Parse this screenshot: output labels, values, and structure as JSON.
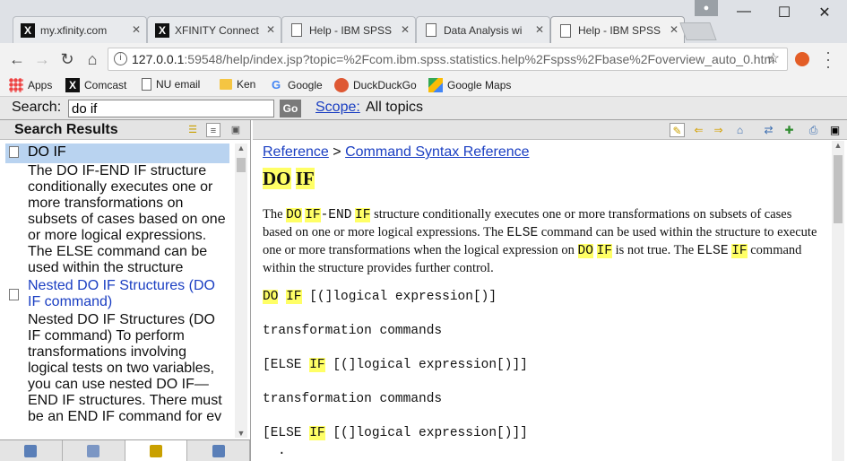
{
  "browser": {
    "tabs": [
      {
        "label": "my.xfinity.com",
        "icon": "xfinity-icon"
      },
      {
        "label": "XFINITY Connect",
        "icon": "xfinity-icon"
      },
      {
        "label": "Help - IBM SPSS",
        "icon": "document-icon"
      },
      {
        "label": "Data Analysis wi",
        "icon": "document-icon"
      },
      {
        "label": "Help - IBM SPSS",
        "icon": "document-icon",
        "active": true
      }
    ],
    "close_glyph": "✕",
    "url_host": "127.0.0.1",
    "url_rest": ":59548/help/index.jsp?topic=%2Fcom.ibm.spss.statistics.help%2Fspss%2Fbase%2Foverview_auto_0.htm",
    "bookmarks": [
      {
        "label": "Apps",
        "icon": "apps-grid-icon"
      },
      {
        "label": "Comcast",
        "icon": "xfinity-icon"
      },
      {
        "label": "NU email",
        "icon": "document-icon"
      },
      {
        "label": "Ken",
        "icon": "folder-icon"
      },
      {
        "label": "Google",
        "icon": "google-icon"
      },
      {
        "label": "DuckDuckGo",
        "icon": "duckduckgo-icon"
      },
      {
        "label": "Google Maps",
        "icon": "google-maps-icon"
      }
    ]
  },
  "search": {
    "label": "Search:",
    "value": "do if",
    "go_label": "Go",
    "scope_label": "Scope:",
    "scope_value": "All topics"
  },
  "left_pane": {
    "title": "Search Results",
    "results": [
      {
        "title": "DO IF",
        "description": "The DO IF-END IF structure conditionally executes one or more transformations on subsets of cases based on one or more logical expressions. The ELSE command can be used within the structure",
        "selected": true
      },
      {
        "title": "Nested DO IF Structures (DO IF command)",
        "description": "Nested DO IF Structures (DO IF command) To perform transformations involving logical tests on two variables, you can use nested DO IF—END IF structures. There must be an END IF command for ev"
      }
    ]
  },
  "content": {
    "breadcrumb": {
      "first": "Reference",
      "sep": ">",
      "second": "Command Syntax Reference"
    },
    "heading_a": "DO",
    "heading_b": "IF",
    "para": {
      "t1": "The",
      "k1": "DO",
      "k2": "IF",
      "k3": "-END",
      "k4": "IF",
      "t2": "structure conditionally executes one or more transformations on subsets of cases based on one or more logical expressions. The",
      "k5": "ELSE",
      "t3": "command can be used within the structure to execute one or more transformations when the logical expression on",
      "k6": "DO",
      "k7": "IF",
      "t4": "is not true. The",
      "k8": "ELSE",
      "k9": "IF",
      "t5": "command within the structure provides further control."
    },
    "syntax": {
      "l1a": "DO",
      "l1b": "IF",
      "l1c": "[(]logical expression[)]",
      "l2": "transformation commands",
      "l3a": "[ELSE",
      "l3b": "IF",
      "l3c": "[(]logical expression[)]]",
      "l4": "transformation commands",
      "l5a": "[ELSE",
      "l5b": "IF",
      "l5c": "[(]logical expression[)]]",
      "l6": "."
    }
  },
  "colors": {
    "highlight": "#ffff66",
    "link": "#1a3ec2",
    "selection": "#b9d3f0"
  }
}
